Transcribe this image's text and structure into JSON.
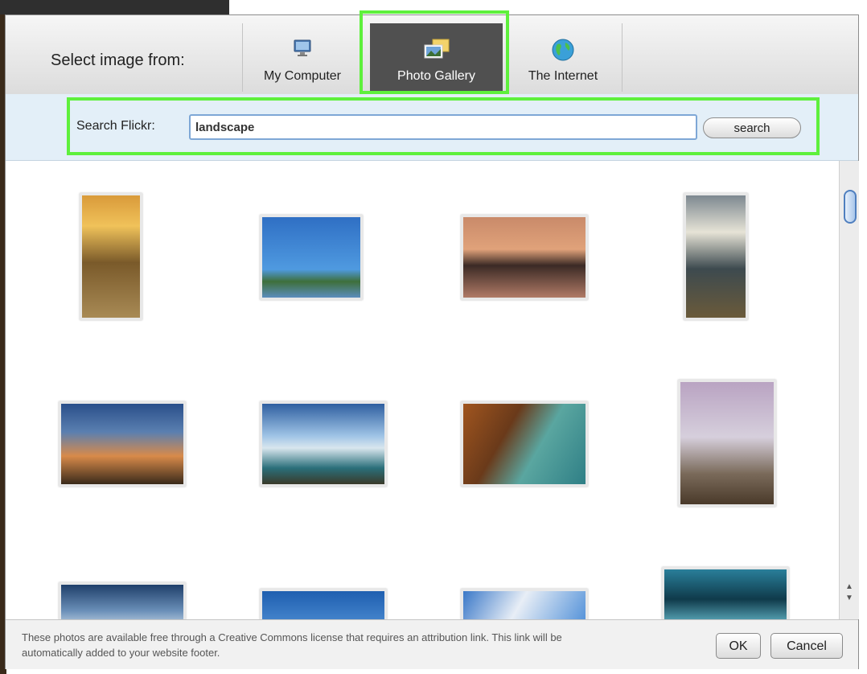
{
  "header": {
    "select_label": "Select image from:",
    "tabs": [
      {
        "label": "My Computer",
        "icon": "monitor-icon"
      },
      {
        "label": "Photo Gallery",
        "icon": "photos-icon",
        "selected": true
      },
      {
        "label": "The Internet",
        "icon": "globe-icon"
      }
    ]
  },
  "search": {
    "label": "Search Flickr:",
    "value": "landscape",
    "button_label": "search"
  },
  "gallery": {
    "thumbnails": [
      {
        "name": "sunset-road"
      },
      {
        "name": "hot-air-balloons"
      },
      {
        "name": "balloons-over-lake"
      },
      {
        "name": "tree-by-lake"
      },
      {
        "name": "bird-flock-sunset"
      },
      {
        "name": "waterfall-dam"
      },
      {
        "name": "coastal-cliff"
      },
      {
        "name": "lone-tree-fog"
      },
      {
        "name": "blue-sky-1"
      },
      {
        "name": "blue-sky-2"
      },
      {
        "name": "cloudy-sky"
      },
      {
        "name": "aurora"
      }
    ]
  },
  "footer": {
    "note": "These photos are available free through a Creative Commons license that requires an attribution link. This link will be automatically added to your website footer.",
    "ok_label": "OK",
    "cancel_label": "Cancel"
  },
  "colors": {
    "highlight": "#5ef03c",
    "selected_tab": "#505050",
    "search_band": "#e3eff8"
  }
}
